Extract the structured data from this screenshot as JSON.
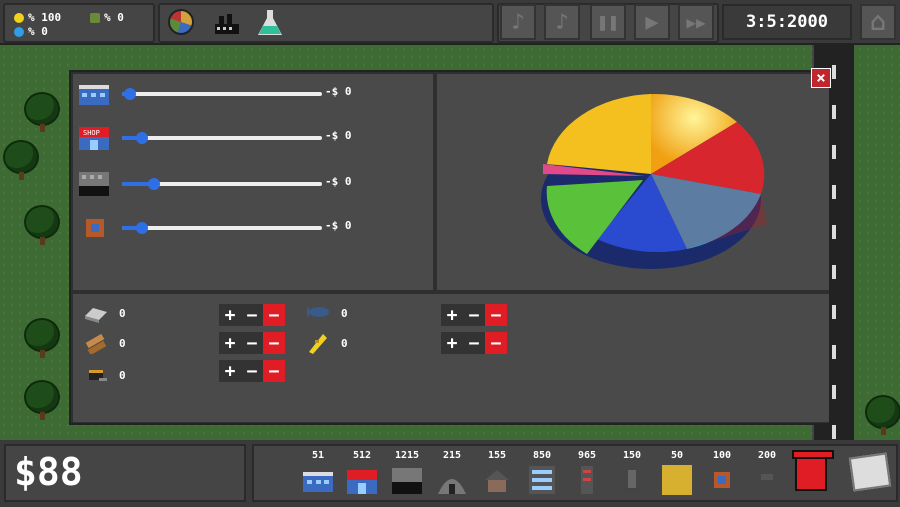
{
  "stats": {
    "happiness": "% 100",
    "pollution": "% 0",
    "unemployment": "% 0"
  },
  "top_buttons": [
    "pie-chart-icon",
    "factory-icon",
    "flask-icon"
  ],
  "controls": {
    "music_on": "♪",
    "music_off": "♪",
    "pause": "❚❚",
    "play": "▶",
    "fast": "▶▶",
    "home": "⌂"
  },
  "clock": "3:5:2000",
  "sliders": [
    {
      "building": "office-building-icon",
      "price": "-$ 0",
      "level": 0.04
    },
    {
      "building": "shop-building-icon",
      "price": "-$ 0",
      "level": 0.1
    },
    {
      "building": "factory-building-icon",
      "price": "-$ 0",
      "level": 0.16
    },
    {
      "building": "small-device-icon",
      "price": "-$ 0",
      "level": 0.1
    }
  ],
  "resources": [
    {
      "name": "metal-icon",
      "value": "0"
    },
    {
      "name": "wood-icon",
      "value": "0"
    },
    {
      "name": "coal-icon",
      "value": "0"
    },
    {
      "name": "fish-icon",
      "value": "0"
    },
    {
      "name": "wheat-icon",
      "value": "0"
    }
  ],
  "pm_labels": {
    "plus": "+",
    "minus": "−",
    "minus2": "−"
  },
  "close": "×",
  "money": "$88",
  "shop": [
    {
      "cost": "51",
      "icon": "office-icon"
    },
    {
      "cost": "512",
      "icon": "shop-icon"
    },
    {
      "cost": "1215",
      "icon": "warehouse-icon"
    },
    {
      "cost": "215",
      "icon": "mine-icon"
    },
    {
      "cost": "155",
      "icon": "house-icon"
    },
    {
      "cost": "850",
      "icon": "apartment-icon"
    },
    {
      "cost": "965",
      "icon": "tower-icon"
    },
    {
      "cost": "150",
      "icon": "statue-icon"
    },
    {
      "cost": "50",
      "icon": "field-icon"
    },
    {
      "cost": "100",
      "icon": "device-icon"
    },
    {
      "cost": "200",
      "icon": "empty-lot-icon"
    }
  ],
  "colors": {
    "accent": "#2e6fe6",
    "danger": "#e01c24",
    "panel": "#4a4a4a"
  }
}
